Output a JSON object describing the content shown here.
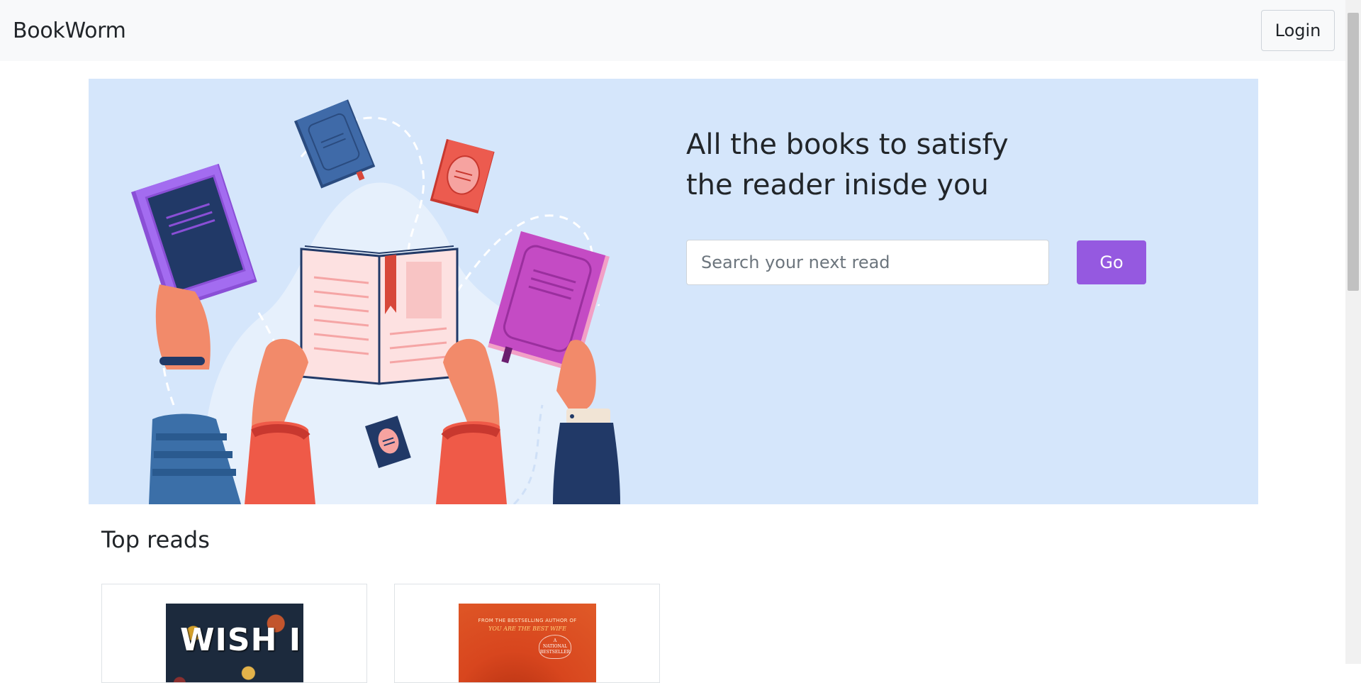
{
  "navbar": {
    "brand": "BookWorm",
    "login_label": "Login"
  },
  "hero": {
    "title_line1": "All the books to satisfy",
    "title_line2": "the reader inisde you",
    "search_placeholder": "Search your next read",
    "search_value": "",
    "go_label": "Go",
    "illustration": "hands-holding-books-illustration"
  },
  "top_reads": {
    "title": "Top reads",
    "books": [
      {
        "cover_text": "WISH I"
      },
      {
        "cover_line1": "FROM THE BESTSELLING AUTHOR OF",
        "cover_line2": "YOU ARE THE BEST WIFE",
        "badge_line1": "A",
        "badge_line2": "NATIONAL",
        "badge_line3": "BESTSELLER"
      }
    ]
  },
  "colors": {
    "accent": "#9559e0",
    "hero_bg": "#d5e6fb",
    "navbar_bg": "#f8f9fa"
  },
  "icons": {
    "scrollbar": "vertical-scrollbar"
  }
}
